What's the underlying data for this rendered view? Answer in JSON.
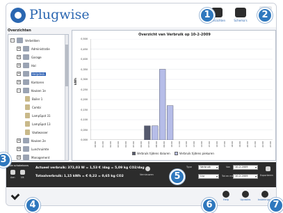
{
  "app": {
    "title": "Plugwise"
  },
  "toolbar": {
    "buttons": [
      {
        "label": "Overzichten"
      },
      {
        "label": "Schema's"
      }
    ]
  },
  "sidebar": {
    "title": "Overzichten",
    "items": [
      {
        "label": "Verbeliken",
        "toggle": "−",
        "level": 0,
        "type": "group"
      },
      {
        "label": "Administratie",
        "toggle": "+",
        "level": 1,
        "type": "group"
      },
      {
        "label": "Garage",
        "toggle": "+",
        "level": 1,
        "type": "group"
      },
      {
        "label": "Hal",
        "toggle": "+",
        "level": 1,
        "type": "group"
      },
      {
        "label": "Helpdesk",
        "toggle": "+",
        "level": 1,
        "type": "group",
        "selected": true
      },
      {
        "label": "Kantoren",
        "toggle": "+",
        "level": 1,
        "type": "group"
      },
      {
        "label": "Keuken 1e",
        "toggle": "−",
        "level": 1,
        "type": "group"
      },
      {
        "label": "Boiler 1",
        "toggle": "",
        "level": 2,
        "type": "device"
      },
      {
        "label": "Combi",
        "toggle": "",
        "level": 2,
        "type": "device"
      },
      {
        "label": "LampSpot 31",
        "toggle": "",
        "level": 2,
        "type": "device"
      },
      {
        "label": "LampSpot 13",
        "toggle": "",
        "level": 2,
        "type": "device"
      },
      {
        "label": "Vaatwasser",
        "toggle": "",
        "level": 2,
        "type": "device"
      },
      {
        "label": "Keuken 2e",
        "toggle": "+",
        "level": 1,
        "type": "group"
      },
      {
        "label": "Lunchruimte",
        "toggle": "+",
        "level": 1,
        "type": "group"
      },
      {
        "label": "Management",
        "toggle": "+",
        "level": 1,
        "type": "group"
      }
    ]
  },
  "chart_data": {
    "type": "bar",
    "title": "Overzicht van Verbruik op 10-2-2009",
    "ylabel": "kWh",
    "ylim": [
      0,
      0.5
    ],
    "yticks": [
      "0,000",
      "0,050",
      "0,100",
      "0,150",
      "0,200",
      "0,250",
      "0,300",
      "0,350",
      "0,400",
      "0,450",
      "0,500"
    ],
    "categories": [
      "00:00",
      "01:00",
      "02:00",
      "03:00",
      "04:00",
      "05:00",
      "06:00",
      "07:00",
      "08:00",
      "09:00",
      "10:00",
      "11:00",
      "12:00",
      "13:00",
      "14:00",
      "15:00",
      "16:00",
      "17:00",
      "18:00",
      "19:00",
      "20:00",
      "21:00",
      "22:00",
      "23:00"
    ],
    "series": [
      {
        "name": "Verbruik tijdens daluren",
        "color": "#555a6e",
        "values": [
          0,
          0,
          0,
          0,
          0,
          0,
          0,
          0.07,
          0,
          0,
          0,
          0,
          0,
          0,
          0,
          0,
          0,
          0,
          0,
          0,
          0,
          0,
          0,
          0
        ]
      },
      {
        "name": "Verbruik tijdens piekuren",
        "color": "#b6bde8",
        "values": [
          0,
          0,
          0,
          0,
          0,
          0,
          0,
          0,
          0.07,
          0.35,
          0.17,
          0,
          0,
          0,
          0,
          0,
          0,
          0,
          0,
          0,
          0,
          0,
          0,
          0
        ]
      }
    ]
  },
  "status": {
    "schedule_label": "Alle schakelaars",
    "on_label": "Aan",
    "off_label": "Uit",
    "actual_usage": "Actueel verbruik: 372,03 W = 1,53 € /dag = 5,09 kg CO2/dag",
    "total_usage": "Totaalverbruik: 1,15 kWh = € 0,22 = 0,65 kg CO2",
    "refresh_label": "Vernieuwen",
    "type_label": "Type",
    "type_value": "Verbruik",
    "period_value": "Uur",
    "from_label": "Van",
    "from_value": "10-2-2009",
    "to_label": "Tot en met",
    "to_value": "10-2-2009",
    "export_label": "Exporteren"
  },
  "bottom_bar": {
    "buttons": [
      {
        "label": "Help"
      },
      {
        "label": "Updates"
      },
      {
        "label": "Instellingen"
      }
    ]
  },
  "callouts": [
    "1",
    "2",
    "3",
    "4",
    "5",
    "6",
    "7"
  ],
  "colors": {
    "brand": "#2b67b1",
    "callout": "#2f78be",
    "dark_panel": "#2c2c2c"
  }
}
